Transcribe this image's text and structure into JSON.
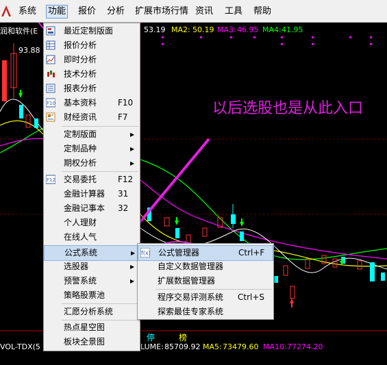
{
  "menubar": {
    "items": [
      "系统",
      "功能",
      "报价",
      "分析",
      "扩展市场行情",
      "资讯",
      "工具",
      "帮助"
    ]
  },
  "chart": {
    "stock_title": "润和软件(E",
    "ma_line": {
      "ma1": "53.19",
      "ma2_label": "MA2:",
      "ma2": "50.19",
      "ma3_label": "MA3:",
      "ma3": "46.95",
      "ma4_label": "MA4:",
      "ma4": "41.95"
    },
    "high_price": "93.88",
    "volume_indicator": "VOL-TDX(5",
    "volume_line": {
      "volume_label": "LUME:",
      "volume": "85709.92",
      "ma5_label": "MA5:",
      "ma5": "73479.60",
      "ma10_label": "MA10:",
      "ma10": "77274.20"
    },
    "tags": [
      "停",
      "榜"
    ]
  },
  "function_menu": {
    "items": [
      {
        "label": "最近定制版面",
        "icon": "layout-icon"
      },
      {
        "label": "报价分析",
        "icon": "grid-icon"
      },
      {
        "label": "即时分析",
        "icon": "line-chart-icon"
      },
      {
        "label": "技术分析",
        "icon": "candlestick-icon"
      },
      {
        "label": "报表分析",
        "icon": "table-icon"
      },
      {
        "label": "基本资料",
        "key": "F10",
        "icon": "f10-icon"
      },
      {
        "label": "财经资讯",
        "key": "F7",
        "icon": "news-icon"
      },
      {
        "label": "定制版面",
        "arrow": "▶"
      },
      {
        "label": "定制品种",
        "arrow": "▶"
      },
      {
        "label": "期权分析",
        "arrow": "▶"
      },
      {
        "label": "交易委托",
        "key": "F12",
        "icon": "f12-icon"
      },
      {
        "label": "金融计算器",
        "key": "31"
      },
      {
        "label": "金融记事本",
        "key": "32"
      },
      {
        "label": "个人理财"
      },
      {
        "label": "在线人气"
      },
      {
        "label": "公式系统",
        "arrow": "▶"
      },
      {
        "label": "选股器",
        "arrow": "▶"
      },
      {
        "label": "预警系统",
        "arrow": "▶"
      },
      {
        "label": "策略股票池"
      },
      {
        "label": "汇愿分析系统"
      },
      {
        "label": "热点星空图"
      },
      {
        "label": "板块全景图"
      }
    ]
  },
  "formula_submenu": {
    "items": [
      {
        "label": "公式管理器",
        "key": "Ctrl+F",
        "icon": "formula-icon"
      },
      {
        "label": "自定义数据管理器"
      },
      {
        "label": "扩展数据管理器"
      },
      {
        "label": "程序交易评测系统",
        "key": "Ctrl+S"
      },
      {
        "label": "探索最佳专家系统"
      }
    ]
  },
  "annotation": "以后选股也是从此入口",
  "colors": {
    "up": "#ff3232",
    "down": "#00ffff",
    "ma1": "#ffffff",
    "ma2": "#ffff00",
    "ma3": "#ff00ff",
    "ma4": "#00ff00",
    "annotation": "#e020e0"
  }
}
